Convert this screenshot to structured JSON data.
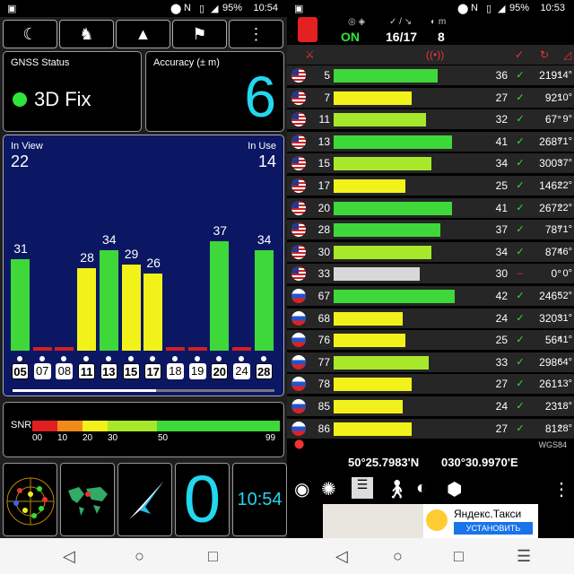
{
  "left_screen": {
    "status": {
      "battery": "95%",
      "time": "10:54"
    },
    "top_buttons": [
      {
        "icon": "moon-icon"
      },
      {
        "icon": "person-icon"
      },
      {
        "icon": "compass-arrow-icon"
      },
      {
        "icon": "map-flags-icon"
      },
      {
        "icon": "more-vert-icon"
      }
    ],
    "gnss": {
      "title": "GNSS Status",
      "fix": "3D Fix"
    },
    "accuracy": {
      "title": "Accuracy (± m)",
      "value": "6"
    },
    "sky": {
      "in_view_label": "In View",
      "in_view": "22",
      "in_use_label": "In Use",
      "in_use": "14"
    },
    "snr_chart": [
      {
        "sv": "05",
        "snr": "31",
        "used": true,
        "color": "#3ed83a"
      },
      {
        "sv": "07",
        "snr": "",
        "used": false,
        "color": "#d22020"
      },
      {
        "sv": "08",
        "snr": "",
        "used": false,
        "color": "#d22020"
      },
      {
        "sv": "11",
        "snr": "28",
        "used": true,
        "color": "#f2f21a"
      },
      {
        "sv": "13",
        "snr": "34",
        "used": true,
        "color": "#3ed83a"
      },
      {
        "sv": "15",
        "snr": "29",
        "used": true,
        "color": "#f2f21a"
      },
      {
        "sv": "17",
        "snr": "26",
        "used": true,
        "color": "#f2f21a"
      },
      {
        "sv": "18",
        "snr": "",
        "used": false,
        "color": "#d22020"
      },
      {
        "sv": "19",
        "snr": "",
        "used": false,
        "color": "#d22020"
      },
      {
        "sv": "20",
        "snr": "37",
        "used": true,
        "color": "#3ed83a"
      },
      {
        "sv": "24",
        "snr": "",
        "used": false,
        "color": "#d22020"
      },
      {
        "sv": "28",
        "snr": "34",
        "used": true,
        "color": "#3ed83a"
      }
    ],
    "snr_scale": {
      "label": "SNR",
      "ticks": [
        "00",
        "10",
        "20",
        "30",
        "50",
        "99"
      ]
    },
    "bottom": {
      "speed": "0",
      "clock": "10:54"
    }
  },
  "right_screen": {
    "status": {
      "battery": "95%",
      "time": "10:53"
    },
    "header": {
      "gps_state": "ON",
      "used_total": "16/17",
      "count": "8"
    },
    "satellites": [
      {
        "id": "5",
        "flag": "us",
        "snr": "36",
        "az": "219°",
        "el": "14°",
        "color": "#3ed83a",
        "used": true
      },
      {
        "id": "7",
        "flag": "us",
        "snr": "27",
        "az": "92°",
        "el": "10°",
        "color": "#f2f21a",
        "used": true
      },
      {
        "id": "11",
        "flag": "us",
        "snr": "32",
        "az": "67°",
        "el": "9°",
        "color": "#a8e82a",
        "used": true
      },
      {
        "id": "13",
        "flag": "us",
        "snr": "41",
        "az": "268°",
        "el": "71°",
        "color": "#3ed83a",
        "used": true
      },
      {
        "id": "15",
        "flag": "us",
        "snr": "34",
        "az": "300°",
        "el": "37°",
        "color": "#a8e82a",
        "used": true
      },
      {
        "id": "17",
        "flag": "us",
        "snr": "25",
        "az": "146°",
        "el": "22°",
        "color": "#f2f21a",
        "used": true
      },
      {
        "id": "20",
        "flag": "us",
        "snr": "41",
        "az": "267°",
        "el": "22°",
        "color": "#3ed83a",
        "used": true
      },
      {
        "id": "28",
        "flag": "us",
        "snr": "37",
        "az": "78°",
        "el": "71°",
        "color": "#3ed83a",
        "used": true
      },
      {
        "id": "30",
        "flag": "us",
        "snr": "34",
        "az": "87°",
        "el": "46°",
        "color": "#a8e82a",
        "used": true
      },
      {
        "id": "33",
        "flag": "us",
        "snr": "30",
        "az": "0°",
        "el": "0°",
        "color": "#d8d8d8",
        "used": false
      },
      {
        "id": "67",
        "flag": "ru",
        "snr": "42",
        "az": "246°",
        "el": "52°",
        "color": "#3ed83a",
        "used": true
      },
      {
        "id": "68",
        "flag": "ru",
        "snr": "24",
        "az": "320°",
        "el": "31°",
        "color": "#f2f21a",
        "used": true
      },
      {
        "id": "76",
        "flag": "ru",
        "snr": "25",
        "az": "56°",
        "el": "41°",
        "color": "#f2f21a",
        "used": true
      },
      {
        "id": "77",
        "flag": "ru",
        "snr": "33",
        "az": "298°",
        "el": "64°",
        "color": "#a8e82a",
        "used": true
      },
      {
        "id": "78",
        "flag": "ru",
        "snr": "27",
        "az": "261°",
        "el": "13°",
        "color": "#f2f21a",
        "used": true
      },
      {
        "id": "85",
        "flag": "ru",
        "snr": "24",
        "az": "23°",
        "el": "18°",
        "color": "#f2f21a",
        "used": true
      },
      {
        "id": "86",
        "flag": "ru",
        "snr": "27",
        "az": "81°",
        "el": "28°",
        "color": "#f2f21a",
        "used": true
      }
    ],
    "datum": "WGS84",
    "lat": "50°25.7983'N",
    "lon": "030°30.9970'E",
    "ad": {
      "title": "Яндекс.Такси",
      "button": "УСТАНОВИТЬ"
    }
  }
}
